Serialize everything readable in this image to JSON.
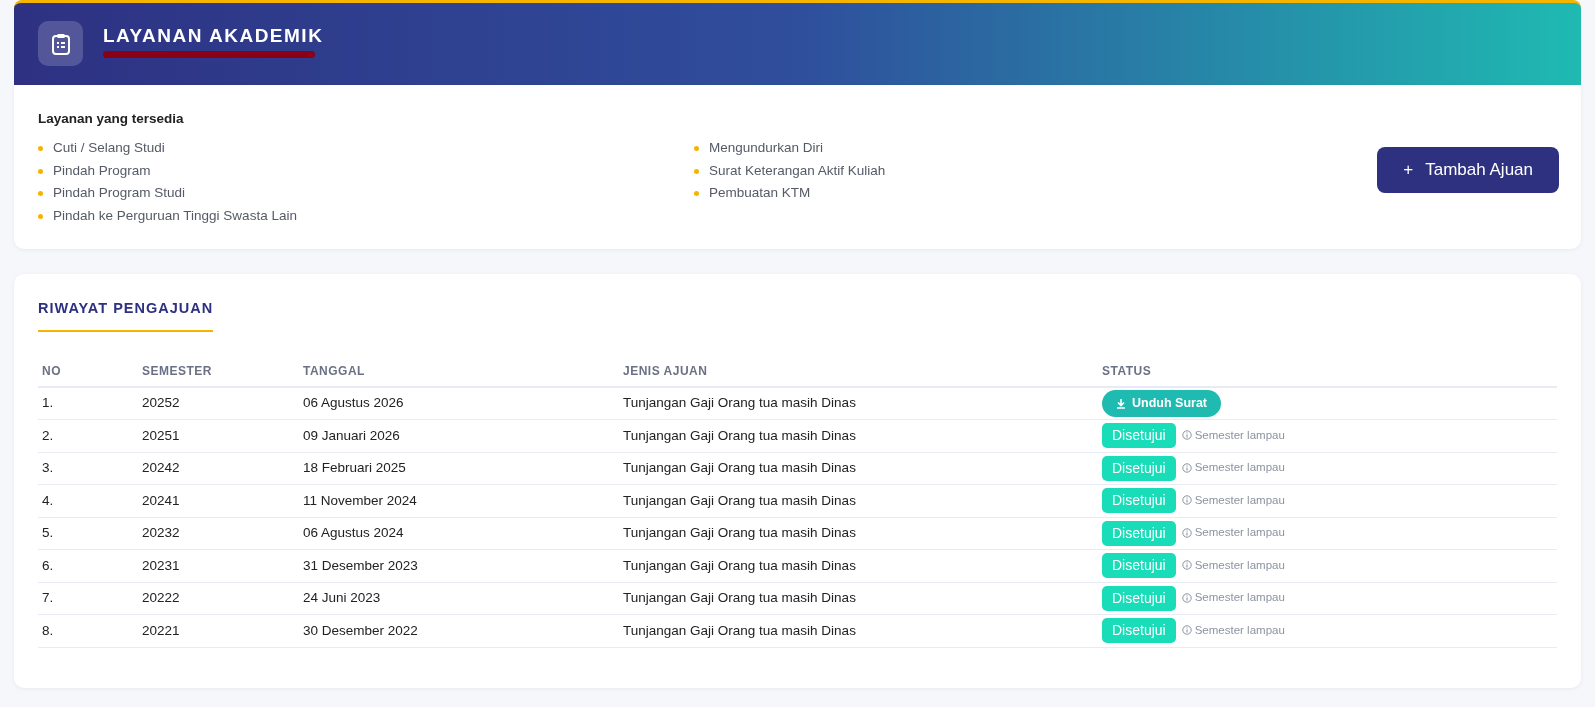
{
  "header": {
    "title": "LAYANAN AKADEMIK",
    "subtitle_redacted": true
  },
  "services": {
    "heading": "Layanan yang tersedia",
    "columns": [
      [
        "Cuti / Selang Studi",
        "Pindah Program",
        "Pindah Program Studi",
        "Pindah ke Perguruan Tinggi Swasta Lain"
      ],
      [
        "Mengundurkan Diri",
        "Surat Keterangan Aktif Kuliah",
        "Pembuatan KTM"
      ]
    ],
    "add_button": {
      "icon": "+",
      "label": "Tambah Ajuan"
    }
  },
  "history": {
    "title": "RIWAYAT PENGAJUAN",
    "columns": [
      "NO",
      "SEMESTER",
      "TANGGAL",
      "JENIS AJUAN",
      "STATUS"
    ],
    "rows": [
      {
        "no": "1.",
        "semester": "20252",
        "date": "06 Agustus 2026",
        "type": "Tunjangan Gaji Orang tua masih Dinas",
        "status": {
          "kind": "download",
          "label": "Unduh Surat"
        }
      },
      {
        "no": "2.",
        "semester": "20251",
        "date": "09 Januari 2026",
        "type": "Tunjangan Gaji Orang tua masih Dinas",
        "status": {
          "kind": "approved",
          "label": "Disetujui",
          "note": "Semester lampau"
        }
      },
      {
        "no": "3.",
        "semester": "20242",
        "date": "18 Februari 2025",
        "type": "Tunjangan Gaji Orang tua masih Dinas",
        "status": {
          "kind": "approved",
          "label": "Disetujui",
          "note": "Semester lampau"
        }
      },
      {
        "no": "4.",
        "semester": "20241",
        "date": "11 November 2024",
        "type": "Tunjangan Gaji Orang tua masih Dinas",
        "status": {
          "kind": "approved",
          "label": "Disetujui",
          "note": "Semester lampau"
        }
      },
      {
        "no": "5.",
        "semester": "20232",
        "date": "06 Agustus 2024",
        "type": "Tunjangan Gaji Orang tua masih Dinas",
        "status": {
          "kind": "approved",
          "label": "Disetujui",
          "note": "Semester lampau"
        }
      },
      {
        "no": "6.",
        "semester": "20231",
        "date": "31 Desember 2023",
        "type": "Tunjangan Gaji Orang tua masih Dinas",
        "status": {
          "kind": "approved",
          "label": "Disetujui",
          "note": "Semester lampau"
        }
      },
      {
        "no": "7.",
        "semester": "20222",
        "date": "24 Juni 2023",
        "type": "Tunjangan Gaji Orang tua masih Dinas",
        "status": {
          "kind": "approved",
          "label": "Disetujui",
          "note": "Semester lampau"
        }
      },
      {
        "no": "8.",
        "semester": "20221",
        "date": "30 Desember 2022",
        "type": "Tunjangan Gaji Orang tua masih Dinas",
        "status": {
          "kind": "approved",
          "label": "Disetujui",
          "note": "Semester lampau"
        }
      }
    ]
  }
}
